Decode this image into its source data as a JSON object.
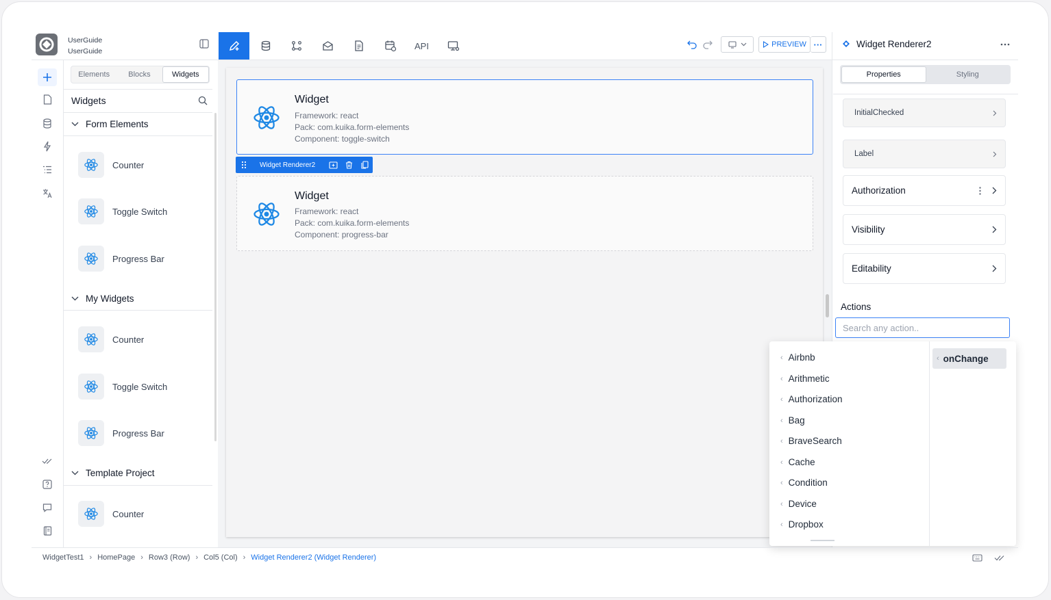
{
  "project": {
    "line1": "UserGuide",
    "line2": "UserGuide"
  },
  "toolbar": {
    "api_label": "API",
    "preview_label": "PREVIEW",
    "more_label": "···"
  },
  "left_panel": {
    "segments": [
      "Elements",
      "Blocks",
      "Widgets"
    ],
    "active_segment": "Widgets",
    "title": "Widgets",
    "sections": [
      {
        "name": "Form Elements",
        "items": [
          "Counter",
          "Toggle Switch",
          "Progress Bar"
        ]
      },
      {
        "name": "My Widgets",
        "items": [
          "Counter",
          "Toggle Switch",
          "Progress Bar"
        ]
      },
      {
        "name": "Template Project",
        "items": [
          "Counter"
        ]
      }
    ]
  },
  "canvas": {
    "cards": [
      {
        "title": "Widget",
        "framework": "Framework: react",
        "pack": "Pack: com.kuika.form-elements",
        "component": "Component: toggle-switch"
      },
      {
        "title": "Widget",
        "framework": "Framework: react",
        "pack": "Pack: com.kuika.form-elements",
        "component": "Component: progress-bar"
      }
    ],
    "selection_label": "Widget Renderer2"
  },
  "right_panel": {
    "title": "Widget Renderer2",
    "tabs": [
      "Properties",
      "Styling"
    ],
    "active_tab": "Properties",
    "small_props": [
      "InitialChecked",
      "Label"
    ],
    "big_props": [
      "Authorization",
      "Visibility",
      "Editability"
    ],
    "actions_label": "Actions",
    "search_placeholder": "Search any action.."
  },
  "dropdown": {
    "items": [
      "Airbnb",
      "Arithmetic",
      "Authorization",
      "Bag",
      "BraveSearch",
      "Cache",
      "Condition",
      "Device",
      "Dropbox"
    ],
    "selected": "onChange"
  },
  "breadcrumb": [
    "WidgetTest1",
    "HomePage",
    "Row3 (Row)",
    "Col5 (Col)",
    "Widget Renderer2 (Widget Renderer)"
  ],
  "colors": {
    "accent": "#1a73e8",
    "react": "#1e88e5"
  }
}
